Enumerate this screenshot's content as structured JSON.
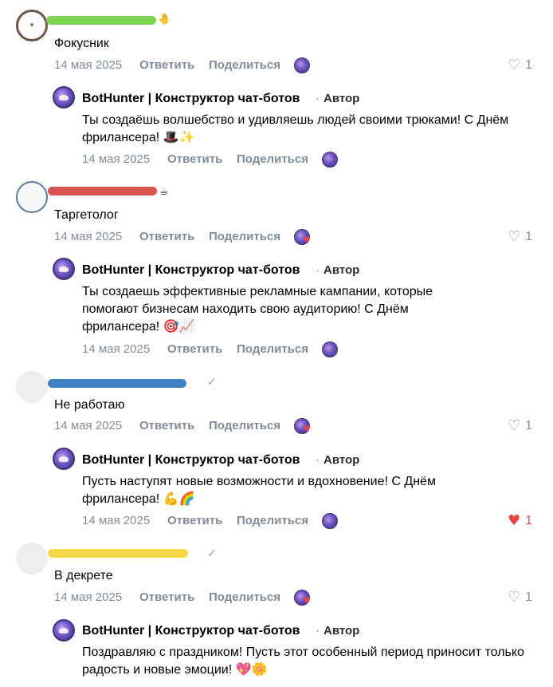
{
  "labels": {
    "reply": "Ответить",
    "share": "Поделиться",
    "author_badge": "Автор"
  },
  "comments": [
    {
      "text": "Фокусник",
      "date": "14 мая 2025",
      "likes": "1",
      "reaction_liked": false,
      "name_color": "#7cd450",
      "reply": {
        "name": "BotHunter | Конструктор чат-ботов",
        "text": "Ты создаёшь волшебство и удивляешь людей своими трюками! С Днём фрилансера! 🎩✨",
        "date": "14 мая 2025",
        "likes": "",
        "liked": false
      }
    },
    {
      "text": "Таргетолог",
      "date": "14 мая 2025",
      "likes": "1",
      "reaction_liked": true,
      "name_color": "#d9534f",
      "reply": {
        "name": "BotHunter | Конструктор чат-ботов",
        "text": "Ты создаешь эффективные рекламные кампании, которые помогают бизнесам находить свою аудиторию! С Днём фрилансера! 🎯📈",
        "date": "14 мая 2025",
        "likes": "",
        "liked": false
      }
    },
    {
      "text": "Не работаю",
      "date": "14 мая 2025",
      "likes": "1",
      "reaction_liked": true,
      "name_color": "#3f7fc4",
      "reply": {
        "name": "BotHunter | Конструктор чат-ботов",
        "text": "Пусть наступят новые возможности и вдохновение! С Днём фрилансера! 💪🌈",
        "date": "14 мая 2025",
        "likes": "1",
        "liked": true
      }
    },
    {
      "text": "В декрете",
      "date": "14 мая 2025",
      "likes": "1",
      "reaction_liked": true,
      "name_color": "#f7d84a",
      "reply": {
        "name": "BotHunter | Конструктор чат-ботов",
        "text": "Поздравляю с праздником! Пусть этот особенный период приносит только радость и новые эмоции! 💖🌼",
        "date": "",
        "likes": "",
        "liked": false
      }
    }
  ],
  "icons": {
    "like": "heart-icon",
    "verified": "checkmark-icon",
    "reaction": "bot-avatar-heart-icon"
  },
  "colors": {
    "meta_gray": "#818c99",
    "like_red": "#e64646"
  }
}
